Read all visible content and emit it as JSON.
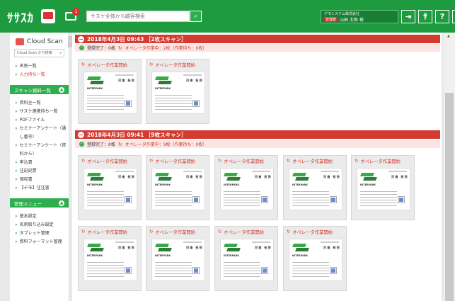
{
  "topbar": {
    "logo_text": "ｻｻｽｶ",
    "mail_badge": "1",
    "search_placeholder": "サスケ全体から顧客検索",
    "user_company": "デモシステム株式会社",
    "user_role": "管理者",
    "user_name": "山田 太郎 様",
    "icons": [
      "export-icon",
      "logo-icon",
      "help-icon",
      "settings-icon"
    ],
    "icon_glyphs": [
      "⇥",
      "ｻ",
      "?",
      "⚙"
    ]
  },
  "sidebar": {
    "title": "Cloud Scan",
    "search_placeholder": "Cloud Scan から検索",
    "nav": [
      {
        "label": "名刺一覧",
        "active": false
      },
      {
        "label": "入力待ち一覧",
        "active": true
      }
    ],
    "section1_title": "スキャン資料一覧",
    "section1_items": [
      "資料全一覧",
      "サスケ連携待ち一覧",
      "PDFファイル",
      "セミナーアンケート（通し番号）",
      "セミナーアンケート（資料から）",
      "申込書",
      "注記記票",
      "領収書",
      "【デモ】注注書"
    ],
    "section2_title": "管理メニュー",
    "section2_items": [
      "基本設定",
      "名刺取り込み設定",
      "タブレット管理",
      "資料フォーマット管理"
    ]
  },
  "groups": [
    {
      "header": "2018年4月3日 09:43 ［2枚スキャン］",
      "status_done": "登録完了：0枚",
      "status_op": "オペレータ作業中：2枚（作業待ち：0枚）",
      "cards": 2
    },
    {
      "header": "2018年4月3日 09:41 ［9枚スキャン］",
      "status_done": "登録完了：0枚",
      "status_op": "オペレータ作業中：9枚（作業待ち：0枚）",
      "cards": 9
    }
  ],
  "card_label": "オペレータ作業開始",
  "card_company": "INTERPARK",
  "card_person": "河 南　拓 弥",
  "colors": {
    "brand_green": "#1d9b3e",
    "alert_red": "#d43a30"
  }
}
